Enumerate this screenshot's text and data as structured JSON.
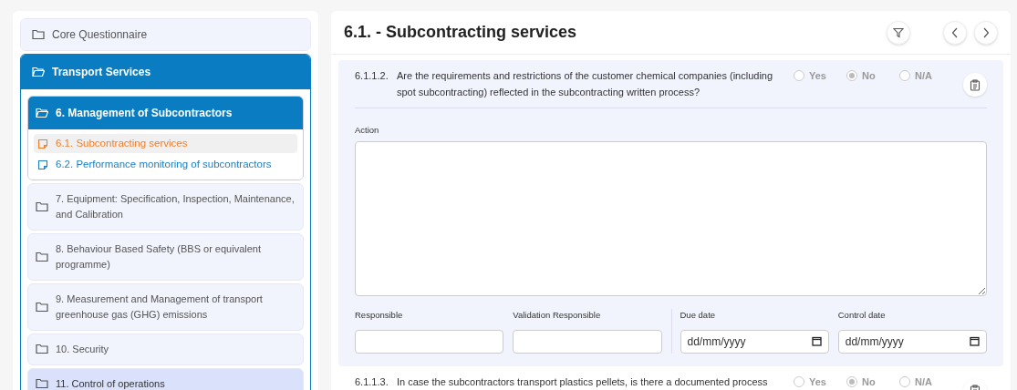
{
  "sidebar": {
    "items": [
      {
        "label": "Core Questionnaire",
        "expanded": false,
        "selected": false
      },
      {
        "label": "Transport Services",
        "expanded": true,
        "children": [
          {
            "label": "6. Management of Subcontractors",
            "expanded": true,
            "children": [
              {
                "label": "6.1. Subcontracting services",
                "selected": true
              },
              {
                "label": "6.2. Performance monitoring of subcontractors",
                "selected": false
              }
            ]
          },
          {
            "label": "7. Equipment: Specification, Inspection, Maintenance, and Calibration",
            "expanded": false,
            "selected": false
          },
          {
            "label": "8. Behaviour Based Safety (BBS or equivalent programme)",
            "expanded": false,
            "selected": false
          },
          {
            "label": "9. Measurement and Management of transport greenhouse gas (GHG) emissions",
            "expanded": false,
            "selected": false
          },
          {
            "label": "10. Security",
            "expanded": false,
            "selected": false
          },
          {
            "label": "11. Control of operations",
            "expanded": false,
            "selected": true
          }
        ]
      }
    ]
  },
  "main": {
    "title": "6.1. - Subcontracting services",
    "questions": [
      {
        "number": "6.1.1.2.",
        "text": "Are the requirements and restrictions of the customer chemical companies (including spot subcontracting) reflected in the subcontracting written process?",
        "options": [
          {
            "label": "Yes",
            "selected": false
          },
          {
            "label": "No",
            "selected": true
          },
          {
            "label": "N/A",
            "selected": false
          }
        ],
        "expanded": true,
        "action_label": "Action",
        "fields": [
          {
            "label": "Responsible",
            "kind": "text"
          },
          {
            "label": "Validation Responsible",
            "kind": "text"
          },
          {
            "label": "Due date",
            "kind": "date",
            "placeholder": "dd/mm/yyyy"
          },
          {
            "label": "Control date",
            "kind": "date",
            "placeholder": "dd/mm/yyyy"
          }
        ]
      },
      {
        "number": "6.1.1.3.",
        "text": "In case the subcontractors transport plastics pellets, is there a documented process",
        "options": [
          {
            "label": "Yes",
            "selected": false
          },
          {
            "label": "No",
            "selected": true
          },
          {
            "label": "N/A",
            "selected": false
          }
        ],
        "expanded": false
      }
    ]
  }
}
